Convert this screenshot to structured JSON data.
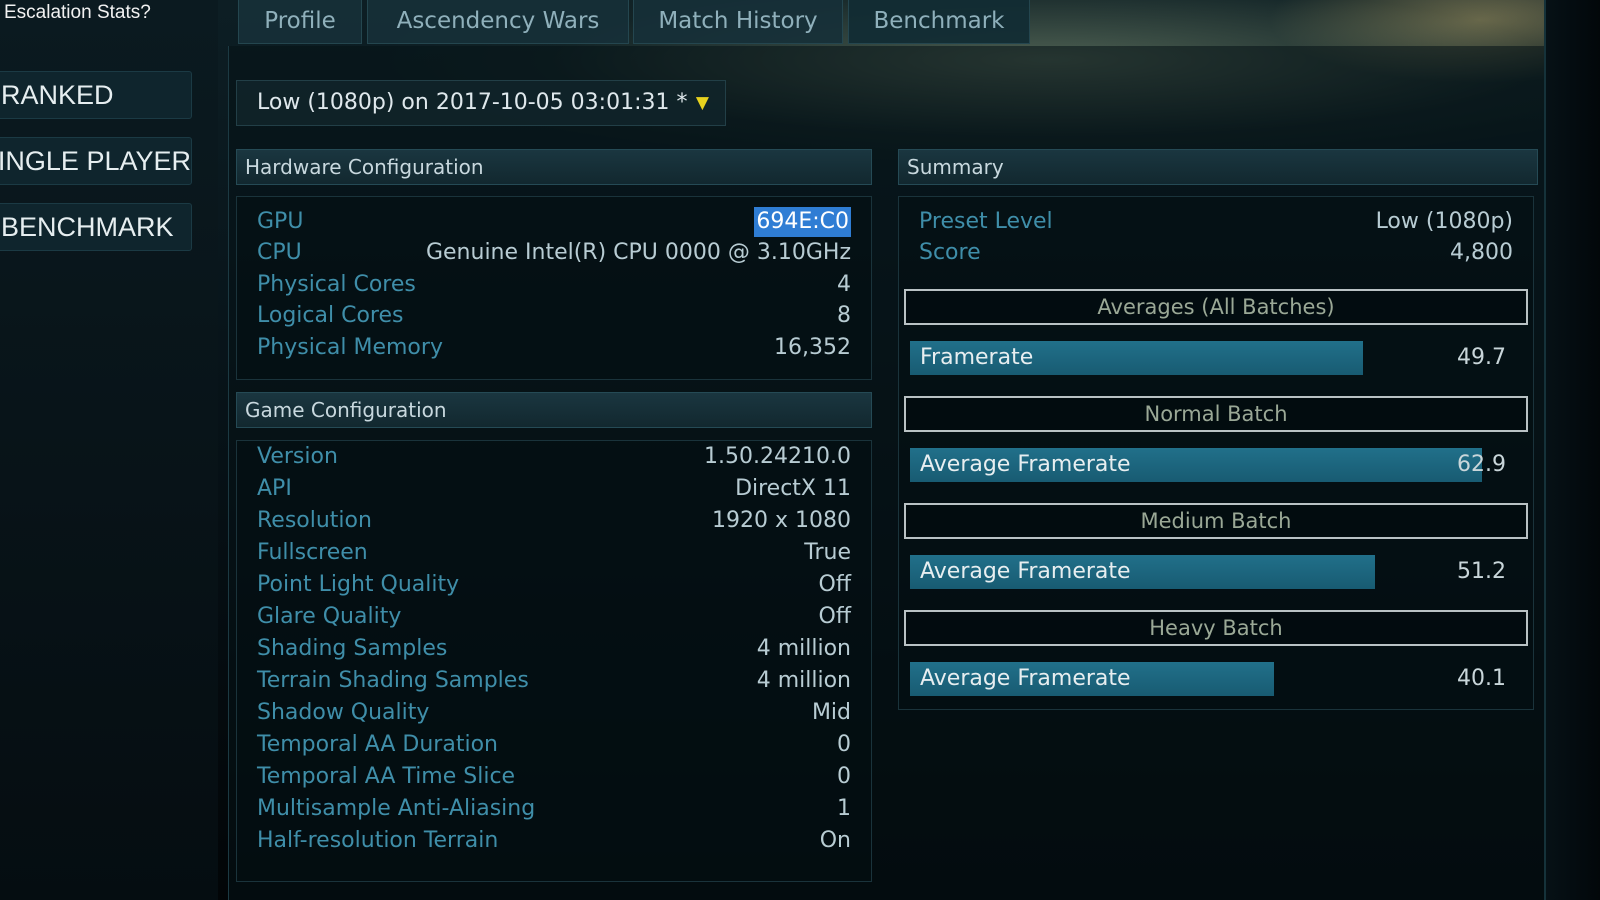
{
  "sidebar": {
    "title": "Escalation Stats?",
    "items": [
      {
        "label": "RANKED"
      },
      {
        "label": "SINGLE PLAYER"
      },
      {
        "label": "BENCHMARK"
      }
    ]
  },
  "tabs": [
    {
      "label": "Profile"
    },
    {
      "label": "Ascendency Wars"
    },
    {
      "label": "Match History"
    },
    {
      "label": "Benchmark"
    }
  ],
  "run_select": {
    "value": "Low (1080p) on 2017-10-05 03:01:31 *",
    "arrow": "▼"
  },
  "hardware": {
    "title": "Hardware Configuration",
    "rows": [
      {
        "label": "GPU",
        "value": "694E:C0"
      },
      {
        "label": "CPU",
        "value": "Genuine Intel(R) CPU 0000 @ 3.10GHz"
      },
      {
        "label": "Physical Cores",
        "value": "4"
      },
      {
        "label": "Logical Cores",
        "value": "8"
      },
      {
        "label": "Physical Memory",
        "value": "16,352"
      }
    ]
  },
  "game": {
    "title": "Game Configuration",
    "rows": [
      {
        "label": "Version",
        "value": "1.50.24210.0"
      },
      {
        "label": "API",
        "value": "DirectX 11"
      },
      {
        "label": "Resolution",
        "value": "1920 x 1080"
      },
      {
        "label": "Fullscreen",
        "value": "True"
      },
      {
        "label": "Point Light Quality",
        "value": "Off"
      },
      {
        "label": "Glare Quality",
        "value": "Off"
      },
      {
        "label": "Shading Samples",
        "value": "4 million"
      },
      {
        "label": "Terrain Shading Samples",
        "value": "4 million"
      },
      {
        "label": "Shadow Quality",
        "value": "Mid"
      },
      {
        "label": "Temporal AA Duration",
        "value": "0"
      },
      {
        "label": "Temporal AA Time Slice",
        "value": "0"
      },
      {
        "label": "Multisample Anti-Aliasing",
        "value": "1"
      },
      {
        "label": "Half-resolution Terrain",
        "value": "On"
      }
    ]
  },
  "summary": {
    "title": "Summary",
    "rows": [
      {
        "label": "Preset Level",
        "value": "Low (1080p)"
      },
      {
        "label": "Score",
        "value": "4,800"
      }
    ],
    "batches": [
      {
        "title": "Averages (All Batches)",
        "metric": "Framerate",
        "value": "49.7",
        "fill": 0.76
      },
      {
        "title": "Normal Batch",
        "metric": "Average Framerate",
        "value": "62.9",
        "fill": 0.96
      },
      {
        "title": "Medium Batch",
        "metric": "Average Framerate",
        "value": "51.2",
        "fill": 0.78
      },
      {
        "title": "Heavy Batch",
        "metric": "Average Framerate",
        "value": "40.1",
        "fill": 0.61
      }
    ]
  },
  "colors": {
    "accent_label": "#3f8ea9",
    "bar_fill": "#1e6a84",
    "dropdown_arrow": "#e8d21e",
    "selection": "#2f7dd4"
  }
}
